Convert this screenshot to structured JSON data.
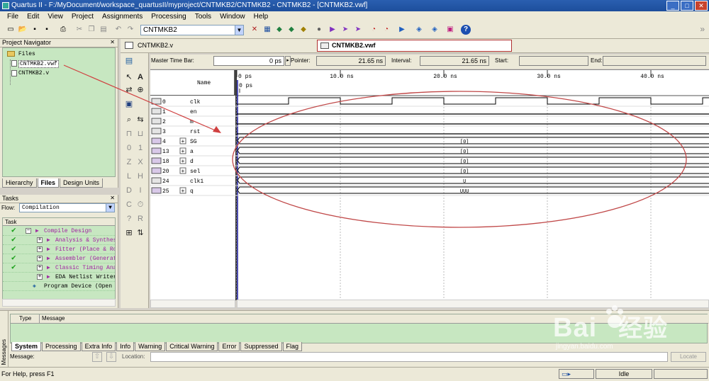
{
  "window": {
    "title": "Quartus II - F:/MyDocument/workspace_quartusII/myproject/CNTMKB2/CNTMKB2 - CNTMKB2 - [CNTMKB2.vwf]"
  },
  "menu": [
    "File",
    "Edit",
    "View",
    "Project",
    "Assignments",
    "Processing",
    "Tools",
    "Window",
    "Help"
  ],
  "toolbar": {
    "entity": "CNTMKB2"
  },
  "project_navigator": {
    "title": "Project Navigator",
    "root": "Files",
    "files": [
      "CNTMKB2.vwf",
      "CNTMKB2.v"
    ],
    "tabs": [
      "Hierarchy",
      "Files",
      "Design Units"
    ]
  },
  "tasks": {
    "title": "Tasks",
    "flow_label": "Flow:",
    "flow_value": "Compilation",
    "column": "Task",
    "items": [
      {
        "label": "Compile Design",
        "done": true,
        "indent": 0
      },
      {
        "label": "Analysis & Synthesis",
        "done": true,
        "indent": 1
      },
      {
        "label": "Fitter (Place & Route)",
        "done": true,
        "indent": 1
      },
      {
        "label": "Assembler (Generate programming files)",
        "done": true,
        "indent": 1
      },
      {
        "label": "Classic Timing Analysis",
        "done": true,
        "indent": 1
      },
      {
        "label": "EDA Netlist Writer",
        "done": false,
        "indent": 1
      },
      {
        "label": "Program Device (Open Programmer)",
        "done": false,
        "indent": 0
      }
    ]
  },
  "doc_tabs": {
    "left": "CNTMKB2.v",
    "active": "CNTMKB2.vwf"
  },
  "waveform": {
    "master_time_bar_label": "Master Time Bar:",
    "master_time_bar_value": "0 ps",
    "pointer_label": "Pointer:",
    "pointer_value": "21.65 ns",
    "interval_label": "Interval:",
    "interval_value": "21.65 ns",
    "start_label": "Start:",
    "end_label": "End:",
    "name_header": "Name",
    "time_ticks": [
      "0 ps",
      "10.0 ns",
      "20.0 ns",
      "30.0 ns",
      "40.0 ns"
    ],
    "cursor_label": "0 ps",
    "signals": [
      {
        "id": "0",
        "name": "clk",
        "expand": false,
        "value": ""
      },
      {
        "id": "1",
        "name": "en",
        "expand": false,
        "value": ""
      },
      {
        "id": "2",
        "name": "m",
        "expand": false,
        "value": ""
      },
      {
        "id": "3",
        "name": "rst",
        "expand": false,
        "value": ""
      },
      {
        "id": "4",
        "name": "SG",
        "expand": true,
        "value": "[0]"
      },
      {
        "id": "13",
        "name": "a",
        "expand": true,
        "value": "[0]"
      },
      {
        "id": "18",
        "name": "d",
        "expand": true,
        "value": "[0]"
      },
      {
        "id": "20",
        "name": "sel",
        "expand": true,
        "value": "[0]"
      },
      {
        "id": "24",
        "name": "clk1",
        "expand": false,
        "value": "U"
      },
      {
        "id": "25",
        "name": "q",
        "expand": true,
        "value": "UUU"
      }
    ]
  },
  "messages": {
    "side_label": "Messages",
    "col_type": "Type",
    "col_message": "Message",
    "tabs": [
      "System",
      "Processing",
      "Extra Info",
      "Info",
      "Warning",
      "Critical Warning",
      "Error",
      "Suppressed",
      "Flag"
    ],
    "message_label": "Message:",
    "location_label": "Location:",
    "locate_button": "Locate"
  },
  "status": {
    "help": "For Help, press F1",
    "state": "Idle"
  },
  "watermark": {
    "brand": "Bai",
    "sub": "jingyan.baidu.com",
    "cn": "经验"
  }
}
